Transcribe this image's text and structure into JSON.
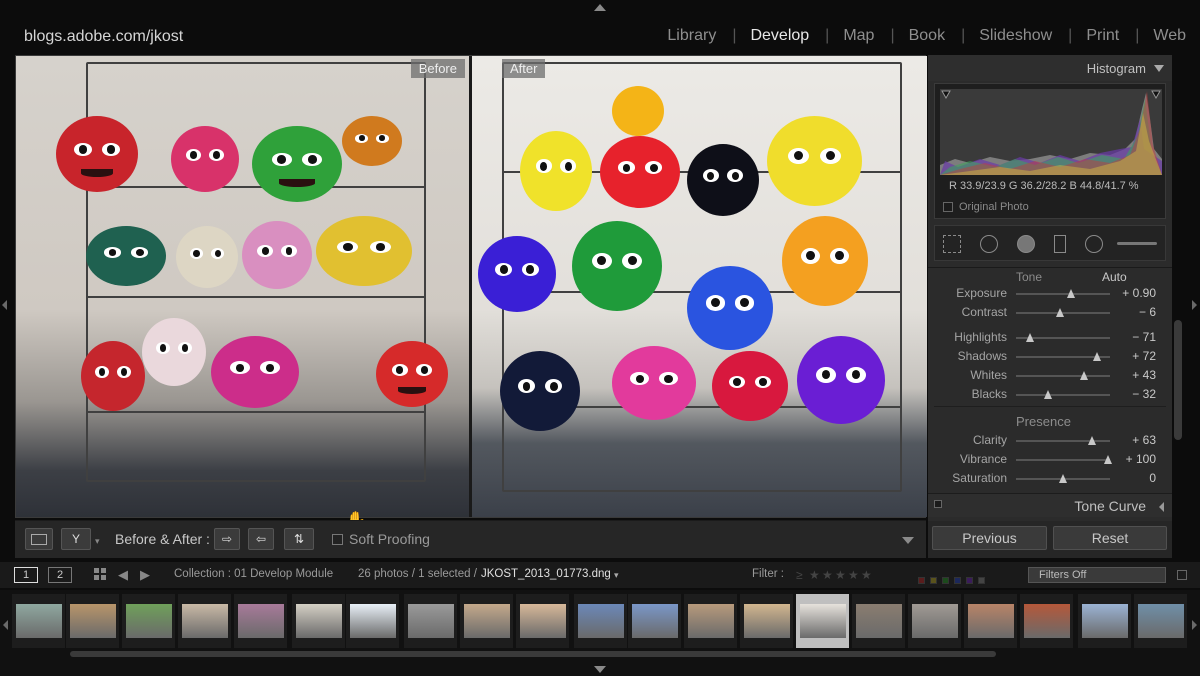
{
  "site": "blogs.adobe.com/jkost",
  "modules": [
    "Library",
    "Develop",
    "Map",
    "Book",
    "Slideshow",
    "Print",
    "Web"
  ],
  "active_module": "Develop",
  "viewer": {
    "before_label": "Before",
    "after_label": "After"
  },
  "toolbar": {
    "before_after_label": "Before & After :",
    "soft_proofing_label": "Soft Proofing"
  },
  "histogram": {
    "title": "Histogram",
    "readout": "R 33.9/23.9  G 36.2/28.2  B 44.8/41.7 %",
    "original_photo_label": "Original Photo"
  },
  "tone": {
    "label": "Tone",
    "auto_label": "Auto",
    "sliders": [
      {
        "label": "Exposure",
        "value": "+ 0.90",
        "pos": 0.59
      },
      {
        "label": "Contrast",
        "value": "− 6",
        "pos": 0.47
      },
      {
        "label": "Highlights",
        "value": "− 71",
        "pos": 0.15
      },
      {
        "label": "Shadows",
        "value": "+ 72",
        "pos": 0.86
      },
      {
        "label": "Whites",
        "value": "+ 43",
        "pos": 0.72
      },
      {
        "label": "Blacks",
        "value": "− 32",
        "pos": 0.34
      }
    ]
  },
  "presence": {
    "label": "Presence",
    "sliders": [
      {
        "label": "Clarity",
        "value": "+ 63",
        "pos": 0.81
      },
      {
        "label": "Vibrance",
        "value": "+ 100",
        "pos": 0.98
      },
      {
        "label": "Saturation",
        "value": "0",
        "pos": 0.5
      }
    ]
  },
  "tone_curve_label": "Tone Curve",
  "buttons": {
    "previous": "Previous",
    "reset": "Reset"
  },
  "filmstrip_bar": {
    "page1": "1",
    "page2": "2",
    "collection": "Collection : 01 Develop Module",
    "count": "26 photos / 1 selected /",
    "filename": "JKOST_2013_01773.dng",
    "filter_label": "Filter :",
    "filter_value": "Filters Off"
  },
  "thumbnails": [
    {
      "color": "#8fa8a0"
    },
    {
      "color": "#b8956a"
    },
    {
      "color": "#6fa05a"
    },
    {
      "color": "#c9b9a6"
    },
    {
      "color": "#a87a9a"
    },
    {
      "color": "#d4cfc4"
    },
    {
      "color": "#e8f0f7"
    },
    {
      "color": "#9a9a9a"
    },
    {
      "color": "#c4a98b"
    },
    {
      "color": "#d7b899"
    },
    {
      "color": "#6b88b8"
    },
    {
      "color": "#7a97c8"
    },
    {
      "color": "#b79a7c"
    },
    {
      "color": "#d2b68f"
    },
    {
      "color": "#e6e2dc"
    },
    {
      "color": "#8a7d70"
    },
    {
      "color": "#a09a94"
    },
    {
      "color": "#b88468"
    },
    {
      "color": "#b5583a"
    },
    {
      "color": "#9bb3d4"
    },
    {
      "color": "#6f8fa8"
    }
  ]
}
